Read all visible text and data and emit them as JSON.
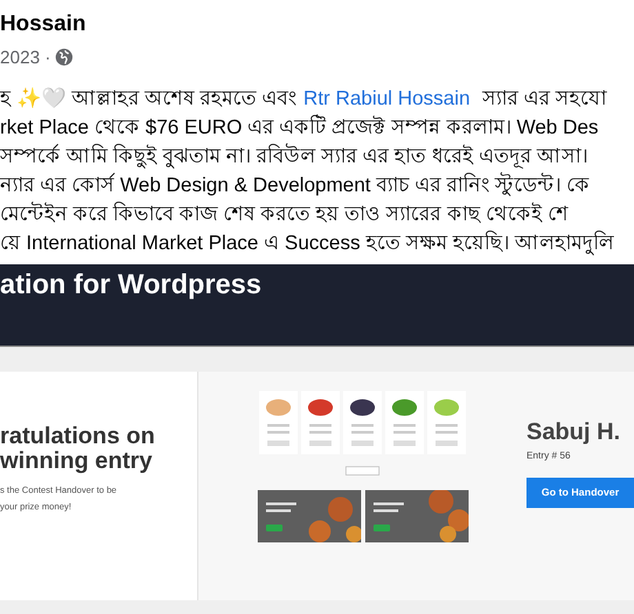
{
  "post": {
    "author": "Hossain",
    "date": "2023 ·",
    "first_line": {
      "before": "হ ✨🤍 আল্লাহর অশেষ রহমতে এবং",
      "link": "Rtr Rabiul Hossain",
      "after": "স্যার এর সহযো"
    },
    "lines": [
      "rket Place থেকে $76 EURO এর একটি প্রজেক্ট সম্পন্ন করলাম।   Web Des",
      "সম্পর্কে আমি কিছুই বুঝতাম না। রবিউল স্যার এর হাত ধরেই এতদূর আসা।",
      "ন্যার এর কোর্স Web Design & Development ব্যাচ এর রানিং স্টুডেন্ট। কে",
      "মেন্টেইন করে কিভাবে কাজ শেষ করতে হয় তাও স্যারের কাছ থেকেই শে",
      "য়ে International Market Place এ Success হতে সক্ষম হয়েছি। আলহামদুলি"
    ]
  },
  "screenshot": {
    "title": "ation for Wordpress",
    "heading": [
      "ratulations on",
      "winning entry"
    ],
    "message": [
      "s the Contest Handover to be",
      "your prize money!"
    ],
    "winner": "Sabuj H.",
    "entry": "Entry # 56",
    "button": "Go to Handover"
  }
}
